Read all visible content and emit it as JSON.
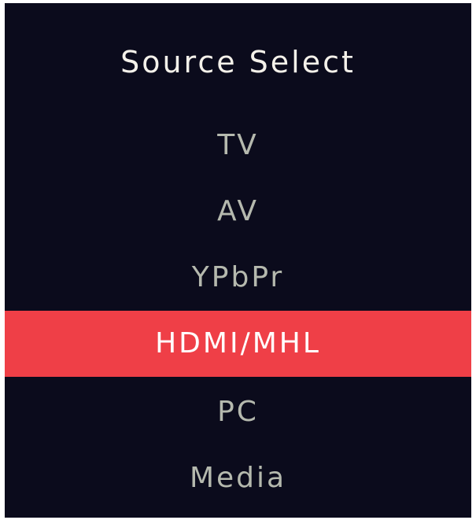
{
  "menu": {
    "title": "Source Select",
    "items": [
      {
        "label": "TV",
        "selected": false
      },
      {
        "label": "AV",
        "selected": false
      },
      {
        "label": "YPbPr",
        "selected": false
      },
      {
        "label": "HDMI/MHL",
        "selected": true
      },
      {
        "label": "PC",
        "selected": false
      },
      {
        "label": "Media",
        "selected": false
      }
    ]
  },
  "colors": {
    "background": "#0b0b1c",
    "highlight": "#ef3f47",
    "item_text": "#b5b9ae",
    "title_text": "#f4f1ea"
  }
}
